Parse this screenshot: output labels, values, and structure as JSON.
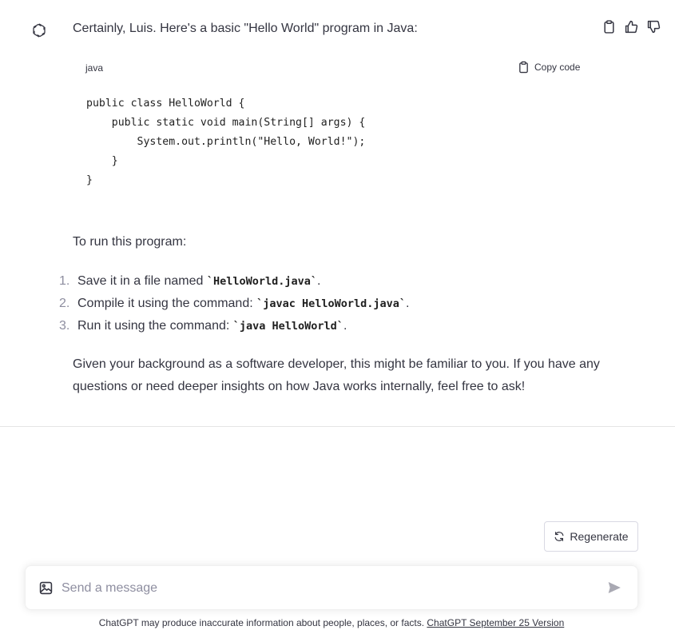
{
  "message": {
    "intro": "Certainly, Luis. Here's a basic \"Hello World\" program in Java:",
    "avatar_icon": "openai-logo-icon",
    "actions": {
      "copy_icon": "clipboard-icon",
      "like_icon": "thumbs-up-icon",
      "dislike_icon": "thumbs-down-icon"
    },
    "code_block": {
      "language": "java",
      "copy_label": "Copy code",
      "copy_icon": "clipboard-icon",
      "code": "public class HelloWorld {\n    public static void main(String[] args) {\n        System.out.println(\"Hello, World!\");\n    }\n}"
    },
    "run_heading": "To run this program:",
    "steps": [
      {
        "num": "1.",
        "before": "Save it in a file named ",
        "code": "`HelloWorld.java`",
        "after": "."
      },
      {
        "num": "2.",
        "before": "Compile it using the command: ",
        "code": "`javac HelloWorld.java`",
        "after": "."
      },
      {
        "num": "3.",
        "before": "Run it using the command: ",
        "code": "`java HelloWorld`",
        "after": "."
      }
    ],
    "closing": "Given your background as a software developer, this might be familiar to you. If you have any questions or need deeper insights on how Java works internally, feel free to ask!"
  },
  "regenerate": {
    "label": "Regenerate",
    "icon": "refresh-icon"
  },
  "composer": {
    "placeholder": "Send a message",
    "value": "",
    "attach_icon": "image-icon",
    "send_icon": "send-icon"
  },
  "footer": {
    "disclaimer": "ChatGPT may produce inaccurate information about people, places, or facts. ",
    "version_link": "ChatGPT September 25 Version"
  },
  "colors": {
    "text": "#343541",
    "muted": "#8e8ea0",
    "border": "#d9d9e3"
  }
}
